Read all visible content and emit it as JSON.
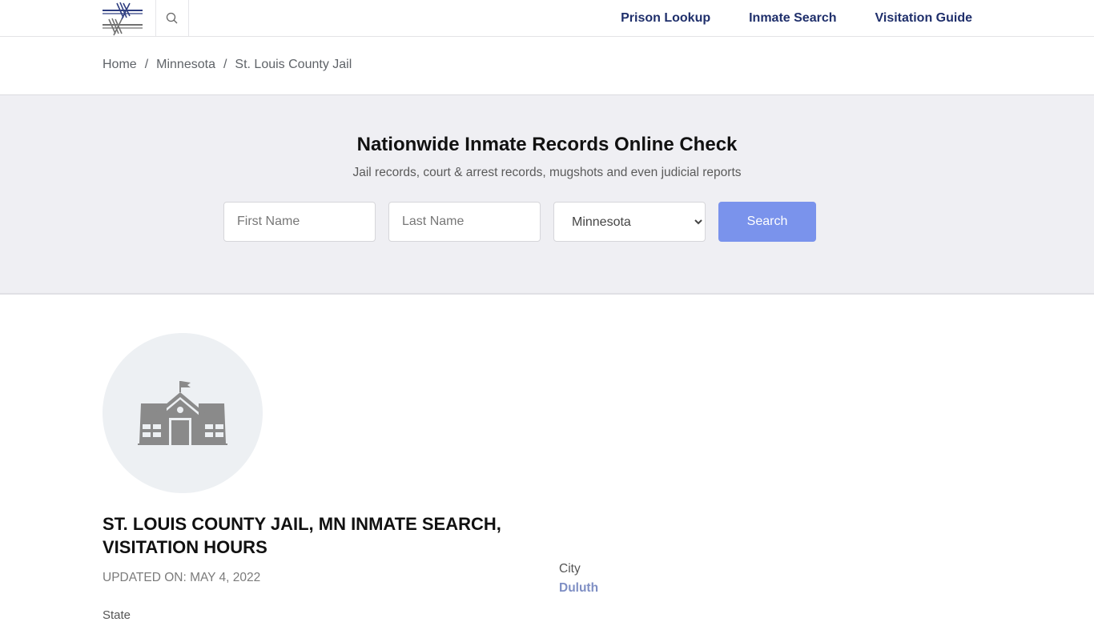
{
  "header": {
    "logo_alt": "barbed-wire logo",
    "search_icon": "search-icon",
    "nav": [
      {
        "label": "Prison Lookup"
      },
      {
        "label": "Inmate Search"
      },
      {
        "label": "Visitation Guide"
      }
    ]
  },
  "breadcrumb": {
    "items": [
      "Home",
      "Minnesota",
      "St. Louis County Jail"
    ],
    "separator": "/"
  },
  "hero": {
    "title": "Nationwide Inmate Records Online Check",
    "subtitle": "Jail records, court & arrest records, mugshots and even judicial reports",
    "first_name_placeholder": "First Name",
    "first_name_value": "",
    "last_name_placeholder": "Last Name",
    "last_name_value": "",
    "state_selected": "Minnesota",
    "search_label": "Search"
  },
  "facility": {
    "image_icon": "building-icon",
    "title": "ST. LOUIS COUNTY JAIL, MN INMATE SEARCH, VISITATION HOURS",
    "updated": "UPDATED ON: MAY 4, 2022",
    "state_label": "State",
    "city_label": "City",
    "city_value": "Duluth"
  },
  "colors": {
    "nav_text": "#1f2f6b",
    "search_button": "#7a93ec",
    "hero_bg": "#efeff3",
    "city_link": "#7f8fc4"
  }
}
